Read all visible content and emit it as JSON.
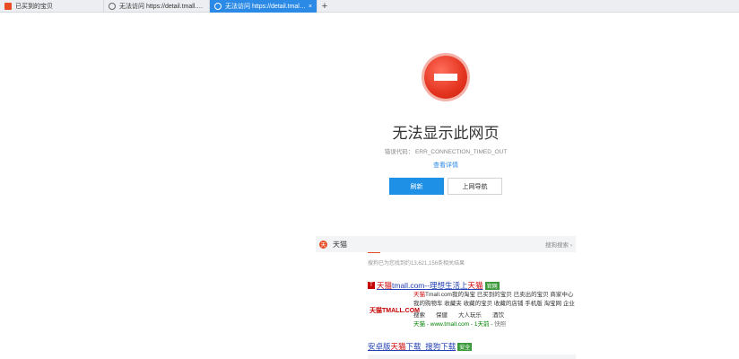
{
  "tabs": [
    {
      "title": "已买到的宝贝",
      "active": false
    },
    {
      "title": "无法访问 https://detail.tmall.com/it",
      "active": false
    },
    {
      "title": "无法访问 https://detail.tmall.com/i",
      "active": true
    }
  ],
  "new_tab_label": "+",
  "tab_close_label": "×",
  "error": {
    "title": "无法显示此网页",
    "code": "错误代码： ERR_CONNECTION_TIMED_OUT",
    "details_link": "查看详情",
    "refresh_button": "刷新",
    "back_button": "上网导航"
  },
  "recommend": {
    "brand_icon_char": "天",
    "title": "天猫",
    "more": "搜狗搜索 ›",
    "result_count": "搜狗已为您找到约13,621,156条相关结果",
    "result1": {
      "icon_char": "T",
      "title_hl": "天猫",
      "title_rest": "tmall.com--理想生活上",
      "title_hl2": "天猫",
      "badge": "官网",
      "logo_text": "天猫TMALL.COM",
      "desc_hl": "天猫",
      "desc": "Tmall.com我的淘宝  已买到的宝贝  已卖出的宝贝  商家中心  我的购物车  收藏夹  收藏的宝贝  收藏的店铺  手机版  淘宝网  企业购  商",
      "links": [
        "搜索",
        "保健",
        "大人玩乐",
        "酒饮"
      ],
      "url_hl": "天猫",
      "url": " - www.tmall.com - 1天前 - ",
      "url_extra": "快照"
    },
    "result2": {
      "prefix": "安卓版",
      "hl": "天猫",
      "suffix": "下载_搜狗下载",
      "badge": "安全"
    }
  },
  "colors": {
    "active_tab": "#2b8ae6",
    "refresh_button": "#1e90e6",
    "stop_icon": "#e3341f",
    "link": "#2440b3",
    "highlight": "#cc0000"
  }
}
